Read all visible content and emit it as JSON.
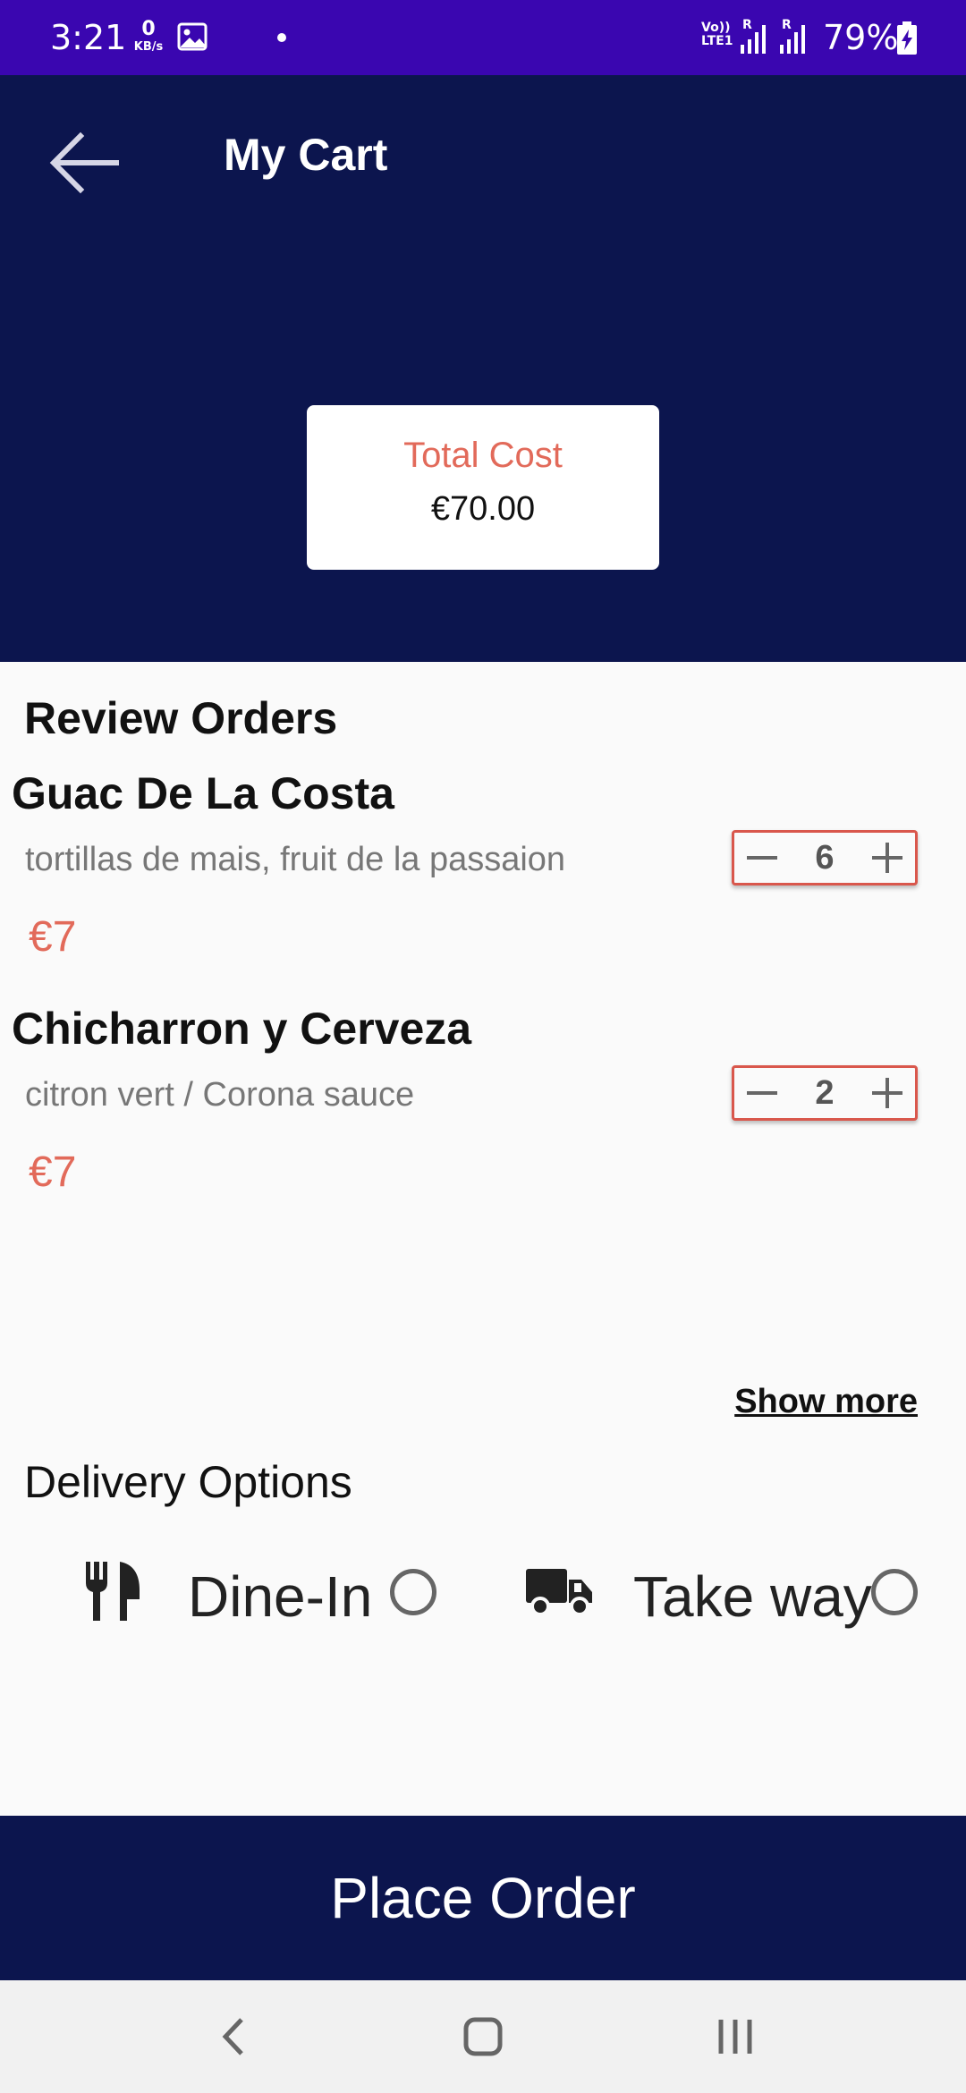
{
  "status_bar": {
    "time": "3:21",
    "net_speed_value": "0",
    "net_speed_unit": "KB/s",
    "volte_line1": "Vo))",
    "volte_line2": "LTE1",
    "roaming1": "R",
    "roaming2": "R",
    "battery": "79%",
    "icons": [
      "gallery-icon",
      "signal-icon",
      "battery-charging-icon"
    ]
  },
  "header": {
    "title": "My Cart",
    "back_icon": "arrow-left-icon",
    "background": "#0c154e",
    "total_label": "Total Cost",
    "total_value": "€70.00"
  },
  "review": {
    "title": "Review Orders",
    "items": [
      {
        "name": "Guac De La Costa",
        "description": "tortillas de mais, fruit de la passaion",
        "price": "€7",
        "quantity": "6"
      },
      {
        "name": "Chicharron y Cerveza",
        "description": "citron vert / Corona sauce",
        "price": "€7",
        "quantity": "2"
      }
    ],
    "show_more": "Show more"
  },
  "delivery": {
    "title": "Delivery Options",
    "options": [
      {
        "label": "Dine-In",
        "icon": "utensils-icon",
        "selected": false
      },
      {
        "label": "Take way",
        "icon": "truck-icon",
        "selected": false
      }
    ]
  },
  "actions": {
    "place_order": "Place Order"
  },
  "colors": {
    "status_bar": "#3a06b0",
    "primary": "#0c154e",
    "accent": "#e26a5a",
    "stepper_border": "#d9574c"
  },
  "nav_bar": {
    "icons": [
      "nav-back-icon",
      "nav-home-icon",
      "nav-recents-icon"
    ]
  }
}
